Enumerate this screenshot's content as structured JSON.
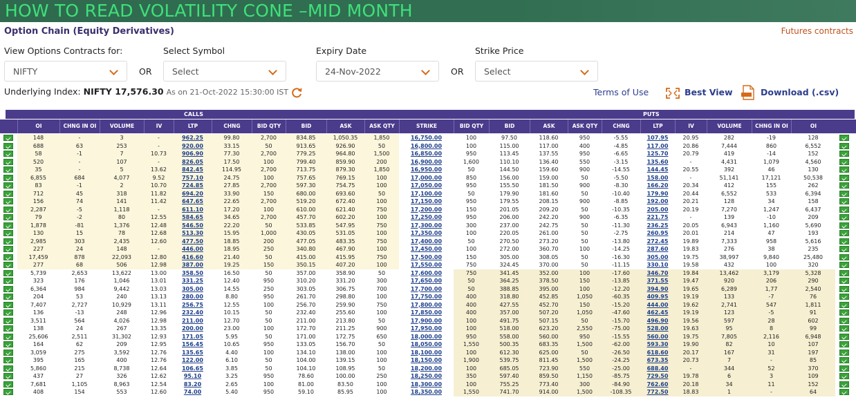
{
  "banner": "HOW TO READ VOLATILITY CONE –MID MONTH",
  "page_title": "Option Chain (Equity Derivatives)",
  "futures_link": "Futures contracts",
  "filters": {
    "view_label": "View Options Contracts for:",
    "view_value": "NIFTY",
    "symbol_label": "Select Symbol",
    "symbol_value": "Select",
    "expiry_label": "Expiry Date",
    "expiry_value": "24-Nov-2022",
    "strike_label": "Strike Price",
    "strike_value": "Select",
    "or_text": "OR"
  },
  "underlying": {
    "prefix": "Underlying Index:",
    "value": "NIFTY 17,576.30",
    "asof": "As on 21-Oct-2022 15:30:00 IST"
  },
  "links": {
    "terms": "Terms of Use",
    "best_view": "Best View",
    "download": "Download (.csv)"
  },
  "table": {
    "calls_label": "CALLS",
    "puts_label": "PUTS",
    "columns": [
      "OI",
      "CHNG IN OI",
      "VOLUME",
      "IV",
      "LTP",
      "CHNG",
      "BID QTY",
      "BID",
      "ASK",
      "ASK QTY",
      "STRIKE",
      "BID QTY",
      "BID",
      "ASK",
      "ASK QTY",
      "CHNG",
      "LTP",
      "IV",
      "VOLUME",
      "CHNG IN OI",
      "OI"
    ],
    "rows": [
      [
        "148",
        "-",
        "3",
        "-",
        "962.25",
        "99.80",
        "2,700",
        "834.85",
        "1,050.35",
        "1,850",
        "16,750.00",
        "100",
        "97.50",
        "118.60",
        "950",
        "-5.55",
        "107.95",
        "20.95",
        "282",
        "-19",
        "128"
      ],
      [
        "688",
        "63",
        "253",
        "-",
        "920.00",
        "33.15",
        "50",
        "913.65",
        "926.90",
        "50",
        "16,800.00",
        "100",
        "115.00",
        "117.00",
        "400",
        "-4.85",
        "117.00",
        "20.86",
        "7,444",
        "860",
        "6,552"
      ],
      [
        "58",
        "-1",
        "7",
        "10.73",
        "906.90",
        "77.30",
        "2,700",
        "779.25",
        "964.80",
        "1,500",
        "16,850.00",
        "950",
        "113.45",
        "137.55",
        "950",
        "-6.65",
        "125.70",
        "20.79",
        "419",
        "-14",
        "152"
      ],
      [
        "520",
        "-",
        "107",
        "-",
        "826.05",
        "17.50",
        "100",
        "799.40",
        "859.90",
        "200",
        "16,900.00",
        "1,600",
        "110.10",
        "136.40",
        "550",
        "-3.15",
        "135.60",
        "-",
        "4,431",
        "1,079",
        "4,560"
      ],
      [
        "35",
        "-",
        "5",
        "13.62",
        "842.45",
        "114.95",
        "2,700",
        "713.75",
        "879.30",
        "1,850",
        "16,950.00",
        "50",
        "144.50",
        "159.60",
        "900",
        "-14.55",
        "144.45",
        "20.55",
        "392",
        "46",
        "130"
      ],
      [
        "6,855",
        "684",
        "4,077",
        "9.52",
        "757.10",
        "24.75",
        "100",
        "757.65",
        "769.15",
        "100",
        "17,000.00",
        "850",
        "156.00",
        "159.00",
        "50",
        "-5.50",
        "158.00",
        "-",
        "51,141",
        "17,121",
        "50,538"
      ],
      [
        "83",
        "-1",
        "2",
        "10.70",
        "724.85",
        "27.85",
        "2,700",
        "597.30",
        "754.75",
        "100",
        "17,050.00",
        "950",
        "155.50",
        "181.50",
        "900",
        "-8.30",
        "166.20",
        "20.34",
        "412",
        "155",
        "262"
      ],
      [
        "712",
        "45",
        "318",
        "11.82",
        "694.20",
        "33.90",
        "150",
        "680.00",
        "693.60",
        "50",
        "17,100.00",
        "50",
        "179.90",
        "181.60",
        "50",
        "-10.40",
        "179.90",
        "20.44",
        "6,552",
        "533",
        "6,394"
      ],
      [
        "156",
        "74",
        "141",
        "11.42",
        "647.65",
        "22.65",
        "2,700",
        "519.20",
        "672.40",
        "100",
        "17,150.00",
        "950",
        "179.55",
        "208.15",
        "900",
        "-8.85",
        "192.00",
        "20.21",
        "128",
        "34",
        "158"
      ],
      [
        "2,287",
        "-5",
        "1,118",
        "-",
        "611.10",
        "17.20",
        "100",
        "610.00",
        "621.40",
        "750",
        "17,200.00",
        "150",
        "201.05",
        "209.20",
        "50",
        "-10.35",
        "205.00",
        "20.19",
        "7,270",
        "1,247",
        "6,437"
      ],
      [
        "79",
        "-2",
        "80",
        "12.55",
        "584.65",
        "34.65",
        "2,700",
        "457.70",
        "602.20",
        "100",
        "17,250.00",
        "950",
        "206.00",
        "242.20",
        "900",
        "-6.35",
        "221.75",
        "-",
        "139",
        "-10",
        "209"
      ],
      [
        "1,878",
        "-81",
        "1,376",
        "12.48",
        "546.50",
        "22.20",
        "50",
        "533.85",
        "547.95",
        "750",
        "17,300.00",
        "300",
        "237.00",
        "242.75",
        "50",
        "-11.30",
        "236.25",
        "20.05",
        "6,943",
        "1,160",
        "5,690"
      ],
      [
        "130",
        "15",
        "78",
        "12.68",
        "513.30",
        "15.95",
        "1,000",
        "430.05",
        "531.05",
        "100",
        "17,350.00",
        "100",
        "220.05",
        "261.00",
        "50",
        "-2.75",
        "260.95",
        "20.01",
        "214",
        "47",
        "193"
      ],
      [
        "2,985",
        "303",
        "2,435",
        "12.60",
        "477.50",
        "18.85",
        "200",
        "477.05",
        "483.35",
        "750",
        "17,400.00",
        "50",
        "270.50",
        "273.20",
        "50",
        "-13.80",
        "272.45",
        "19.89",
        "7,333",
        "958",
        "5,616"
      ],
      [
        "227",
        "24",
        "148",
        "-",
        "446.00",
        "18.95",
        "250",
        "340.80",
        "467.90",
        "100",
        "17,450.00",
        "100",
        "272.00",
        "360.70",
        "100",
        "-14.25",
        "287.60",
        "19.83",
        "276",
        "38",
        "235"
      ],
      [
        "17,459",
        "878",
        "22,093",
        "12.80",
        "416.60",
        "21.40",
        "50",
        "415.00",
        "415.95",
        "750",
        "17,500.00",
        "150",
        "305.00",
        "308.05",
        "50",
        "-16.30",
        "305.00",
        "19.75",
        "38,997",
        "9,840",
        "25,480"
      ],
      [
        "277",
        "68",
        "506",
        "12.98",
        "387.00",
        "19.25",
        "150",
        "350.15",
        "407.20",
        "100",
        "17,550.00",
        "750",
        "324.45",
        "370.00",
        "50",
        "-11.15",
        "330.10",
        "19.58",
        "432",
        "100",
        "320"
      ],
      [
        "5,739",
        "2,653",
        "13,622",
        "13.00",
        "358.50",
        "16.50",
        "50",
        "357.00",
        "358.90",
        "50",
        "17,600.00",
        "750",
        "341.45",
        "352.00",
        "100",
        "-17.60",
        "346.70",
        "19.84",
        "13,462",
        "3,179",
        "5,328"
      ],
      [
        "323",
        "176",
        "1,046",
        "13.01",
        "331.25",
        "12.40",
        "950",
        "310.20",
        "331.20",
        "300",
        "17,650.00",
        "50",
        "364.25",
        "378.50",
        "150",
        "-13.85",
        "371.55",
        "19.47",
        "920",
        "206",
        "290"
      ],
      [
        "6,364",
        "984",
        "9,442",
        "13.03",
        "305.00",
        "14.55",
        "250",
        "303.05",
        "306.75",
        "700",
        "17,700.00",
        "50",
        "388.85",
        "395.00",
        "100",
        "-12.20",
        "394.90",
        "19.65",
        "6,289",
        "1,77",
        "2,540"
      ],
      [
        "204",
        "53",
        "240",
        "13.13",
        "280.00",
        "8.80",
        "950",
        "261.70",
        "298.80",
        "100",
        "17,750.00",
        "400",
        "318.80",
        "452.85",
        "1,050",
        "-60.35",
        "409.95",
        "19.19",
        "133",
        "-7",
        "76"
      ],
      [
        "7,407",
        "2,727",
        "10,929",
        "13.11",
        "256.75",
        "12.55",
        "100",
        "256.70",
        "259.90",
        "750",
        "17,800.00",
        "400",
        "427.55",
        "452.70",
        "150",
        "-15.20",
        "444.00",
        "19.62",
        "2,741",
        "547",
        "1,811"
      ],
      [
        "136",
        "-13",
        "248",
        "12.96",
        "232.40",
        "10.15",
        "50",
        "232.40",
        "255.60",
        "100",
        "17,850.00",
        "400",
        "357.00",
        "507.20",
        "1,050",
        "-47.60",
        "462.45",
        "19.19",
        "123",
        "-5",
        "91"
      ],
      [
        "3,511",
        "564",
        "4,026",
        "12.98",
        "211.00",
        "12.70",
        "50",
        "211.00",
        "213.80",
        "50",
        "17,900.00",
        "100",
        "491.75",
        "507.15",
        "50",
        "-15.70",
        "496.90",
        "19.56",
        "597",
        "28",
        "602"
      ],
      [
        "138",
        "24",
        "267",
        "13.35",
        "200.00",
        "23.00",
        "100",
        "172.70",
        "211.25",
        "900",
        "17,950.00",
        "100",
        "518.00",
        "623.20",
        "2,550",
        "-75.00",
        "528.00",
        "19.63",
        "95",
        "8",
        "99"
      ],
      [
        "25,606",
        "2,511",
        "31,302",
        "12.93",
        "171.05",
        "5.95",
        "50",
        "171.00",
        "172.75",
        "650",
        "18,000.00",
        "950",
        "558.00",
        "560.00",
        "950",
        "-15.55",
        "560.00",
        "19.75",
        "7,805",
        "2,116",
        "6,948"
      ],
      [
        "164",
        "62",
        "209",
        "12.95",
        "156.45",
        "10.65",
        "950",
        "133.05",
        "156.70",
        "50",
        "18,050.00",
        "1,550",
        "500.35",
        "683.35",
        "1,500",
        "-62.00",
        "593.30",
        "19.90",
        "82",
        "10",
        "107"
      ],
      [
        "3,059",
        "275",
        "3,592",
        "12.76",
        "135.65",
        "4.40",
        "100",
        "134.10",
        "138.00",
        "100",
        "18,100.00",
        "100",
        "612.30",
        "625.00",
        "50",
        "-26.50",
        "618.60",
        "20.17",
        "167",
        "31",
        "197"
      ],
      [
        "395",
        "165",
        "400",
        "12.76",
        "122.00",
        "6.10",
        "50",
        "104.00",
        "139.15",
        "100",
        "18,150.00",
        "1,900",
        "539.75",
        "811.45",
        "1,500",
        "-24.25",
        "673.35",
        "20.73",
        "7",
        "-",
        "85"
      ],
      [
        "5,860",
        "215",
        "8,738",
        "12.64",
        "106.65",
        "3.85",
        "50",
        "104.10",
        "108.95",
        "50",
        "18,200.00",
        "100",
        "685.05",
        "723.90",
        "550",
        "-25.00",
        "688.40",
        "-",
        "344",
        "52",
        "370"
      ],
      [
        "437",
        "27",
        "326",
        "12.62",
        "95.10",
        "3.25",
        "950",
        "78.60",
        "100.00",
        "250",
        "18,250.00",
        "350",
        "597.40",
        "859.50",
        "1,150",
        "-85.75",
        "729.50",
        "19.78",
        "6",
        "3",
        "109"
      ],
      [
        "7,681",
        "1,105",
        "8,963",
        "12.54",
        "83.20",
        "2.65",
        "100",
        "81.00",
        "83.50",
        "100",
        "18,300.00",
        "100",
        "755.25",
        "773.40",
        "300",
        "-84.90",
        "762.60",
        "20.18",
        "34",
        "11",
        "152"
      ],
      [
        "408",
        "154",
        "553",
        "12.60",
        "74.00",
        "5.40",
        "950",
        "59.10",
        "85.95",
        "100",
        "18,350.00",
        "1,550",
        "741.70",
        "914.00",
        "1,500",
        "-108.35",
        "772.50",
        "18.83",
        "1",
        "-",
        "64"
      ]
    ]
  },
  "colors": {
    "banner_bg": "#326f52",
    "banner_text": "#3fe07a",
    "header_bg": "#4b3b8b",
    "itm_call_bg": "#fbf6dc",
    "otm_bg": "#ffffff",
    "itm_put_bg": "#f6efd2",
    "accent": "#d46a1a",
    "link": "#2d3e8a"
  },
  "icons": {
    "dropdown": "chevron-down-icon",
    "refresh": "refresh-icon",
    "best_view": "expand-icon",
    "download": "csv-file-icon",
    "row_marker": "checkbox-icon"
  }
}
